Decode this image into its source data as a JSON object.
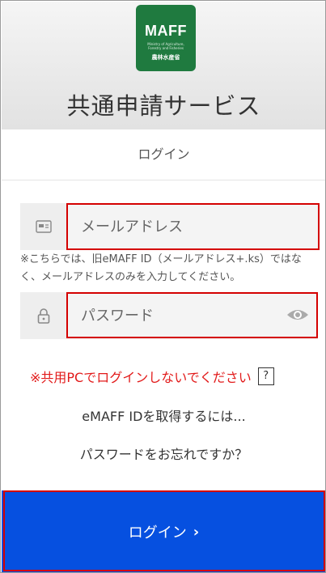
{
  "header": {
    "logo": {
      "main": "MAFF",
      "sub": "Ministry of Agriculture, Forestry and Fisheries",
      "jp": "農林水産省"
    },
    "title": "共通申請サービス"
  },
  "tab": {
    "login_label": "ログイン"
  },
  "form": {
    "email_placeholder": "メールアドレス",
    "note": "※こちらでは、旧eMAFF ID（メールアドレス+.ks）ではなく、メールアドレスのみを入力してください。",
    "password_placeholder": "パスワード"
  },
  "warning": {
    "text": "※共用PCでログインしないでください",
    "help": "?"
  },
  "links": {
    "get_id": "eMAFF IDを取得するには...",
    "forgot_password": "パスワードをお忘れですか？"
  },
  "login_button": {
    "label": "ログイン",
    "chevron": "›"
  },
  "colors": {
    "brand_green": "#1f7a3f",
    "primary_blue": "#0650e0",
    "warning_red": "#e21a1a",
    "highlight_red": "#d40000"
  },
  "icons": {
    "email": "id-card-icon",
    "password": "lock-icon",
    "toggle": "eye-icon"
  }
}
